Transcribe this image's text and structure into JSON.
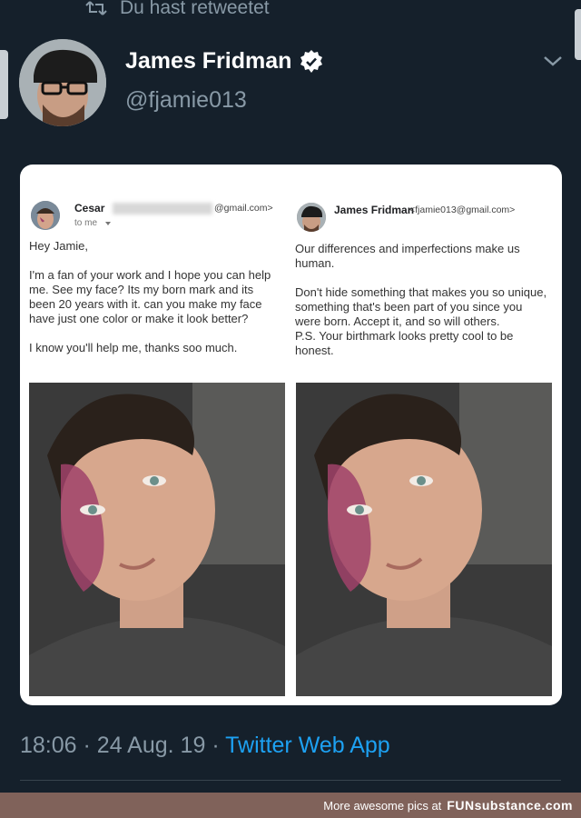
{
  "context_bar": {
    "text": "Du hast retweetet",
    "icon": "retweet-icon"
  },
  "author": {
    "display_name": "James Fridman",
    "handle": "@fjamie013",
    "verified": true
  },
  "email_left": {
    "sender": "Cesar",
    "sender_email_suffix": "@gmail.com>",
    "to_line": "to me",
    "body": [
      "Hey Jamie,",
      "I'm a fan of your work and I hope you can help me. See my face? Its my born mark and its been 20 years with it. can you make my face have just one color or make it look better?",
      "I know you'll help me, thanks soo much."
    ]
  },
  "email_right": {
    "sender": "James Fridman",
    "sender_email": "<fjamie013@gmail.com>",
    "body": [
      "Our differences and imperfections make us human.",
      "Don't hide something that makes you so unique, something that's been part of you since you were born. Accept it, and so will others.\nP.S. Your birthmark looks pretty cool to be honest."
    ]
  },
  "tweet_meta": {
    "time": "18:06",
    "date": "24 Aug. 19",
    "separator": "·",
    "via": "Twitter Web App"
  },
  "footer": {
    "text": "More awesome pics at",
    "brand": "FUNsubstance.com"
  },
  "colors": {
    "background": "#15202b",
    "accent": "#1da1f2",
    "muted": "#8899a6",
    "birthmark": "#a0426a"
  }
}
